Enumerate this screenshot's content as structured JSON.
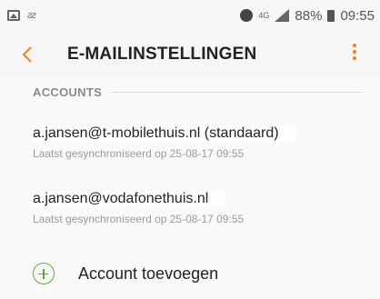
{
  "status_bar": {
    "left_glyph": "ƨƨ",
    "network": "4G",
    "battery": "88%",
    "time": "09:55",
    "icons": [
      "gallery-icon",
      "alarm-icon",
      "signal-icon",
      "battery-icon"
    ]
  },
  "header": {
    "title": "E-MAILINSTELLINGEN",
    "accent_color": "#f0821e"
  },
  "section": {
    "label": "ACCOUNTS"
  },
  "accounts": [
    {
      "email": "a.jansen@t-mobilethuis.nl (standaard)",
      "sync": "Laatst gesynchroniseerd op 25-08-17 09:55"
    },
    {
      "email": "a.jansen@vodafonethuis.nl",
      "sync": "Laatst gesynchroniseerd op 25-08-17 09:55"
    }
  ],
  "add_account": {
    "label": "Account toevoegen",
    "icon_color": "#5aa83a"
  }
}
